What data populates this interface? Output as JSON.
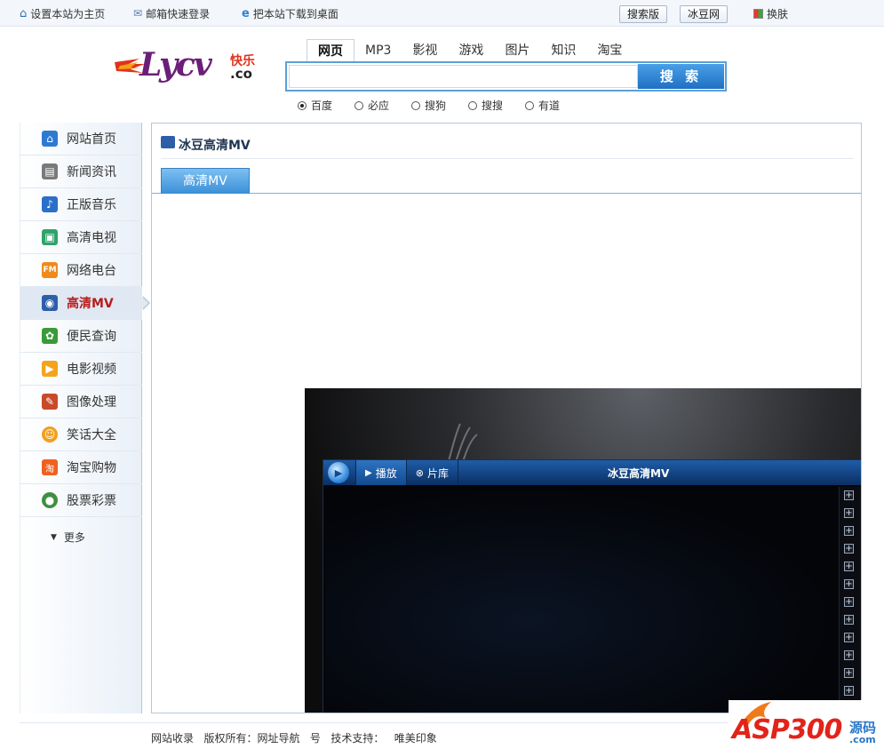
{
  "topbar": {
    "links": [
      "设置本站为主页",
      "邮箱快速登录",
      "把本站下载到桌面"
    ],
    "buttons": [
      "搜索版",
      "冰豆网"
    ],
    "skin_label": "换肤"
  },
  "logo": {
    "text": "Lycv",
    "sub_top": "快乐",
    "sub_bottom": ".co"
  },
  "search": {
    "tabs": [
      "网页",
      "MP3",
      "影视",
      "游戏",
      "图片",
      "知识",
      "淘宝"
    ],
    "active_tab": 0,
    "input_value": "",
    "button_label": "搜 索",
    "engines": [
      "百度",
      "必应",
      "搜狗",
      "搜搜",
      "有道"
    ],
    "selected_engine": 0
  },
  "sidebar": {
    "items": [
      {
        "label": "网站首页",
        "icon": "home-icon",
        "color": "#2f7ad1"
      },
      {
        "label": "新闻资讯",
        "icon": "news-icon",
        "color": "#7a7a7a"
      },
      {
        "label": "正版音乐",
        "icon": "music-icon",
        "color": "#2a6fc9"
      },
      {
        "label": "高清电视",
        "icon": "tv-icon",
        "color": "#2fa36b"
      },
      {
        "label": "网络电台",
        "icon": "fm-radio-icon",
        "color": "#f08a1c"
      },
      {
        "label": "高清MV",
        "icon": "mv-icon",
        "color": "#2d5ea8"
      },
      {
        "label": "便民查询",
        "icon": "query-icon",
        "color": "#3a9a3a"
      },
      {
        "label": "电影视频",
        "icon": "movie-icon",
        "color": "#f2a51c"
      },
      {
        "label": "图像处理",
        "icon": "image-edit-icon",
        "color": "#c94a2a"
      },
      {
        "label": "笑话大全",
        "icon": "smiley-icon",
        "color": "#f0a020"
      },
      {
        "label": "淘宝购物",
        "icon": "taobao-icon",
        "color": "#f06020"
      },
      {
        "label": "股票彩票",
        "icon": "stock-icon",
        "color": "#3f8f3f"
      }
    ],
    "active_index": 5,
    "more_label": "更多"
  },
  "main": {
    "title": "冰豆高清MV",
    "tab_label": "高清MV"
  },
  "player": {
    "play_label": "播放",
    "library_label": "片库",
    "title": "冰豆高清MV"
  },
  "footer": {
    "text": "网站收录   版权所有：网址导航   号   技术支持：   唯美印象"
  },
  "watermark": {
    "text": "ASP300",
    "suffix": "源码",
    "tld": ".com"
  }
}
